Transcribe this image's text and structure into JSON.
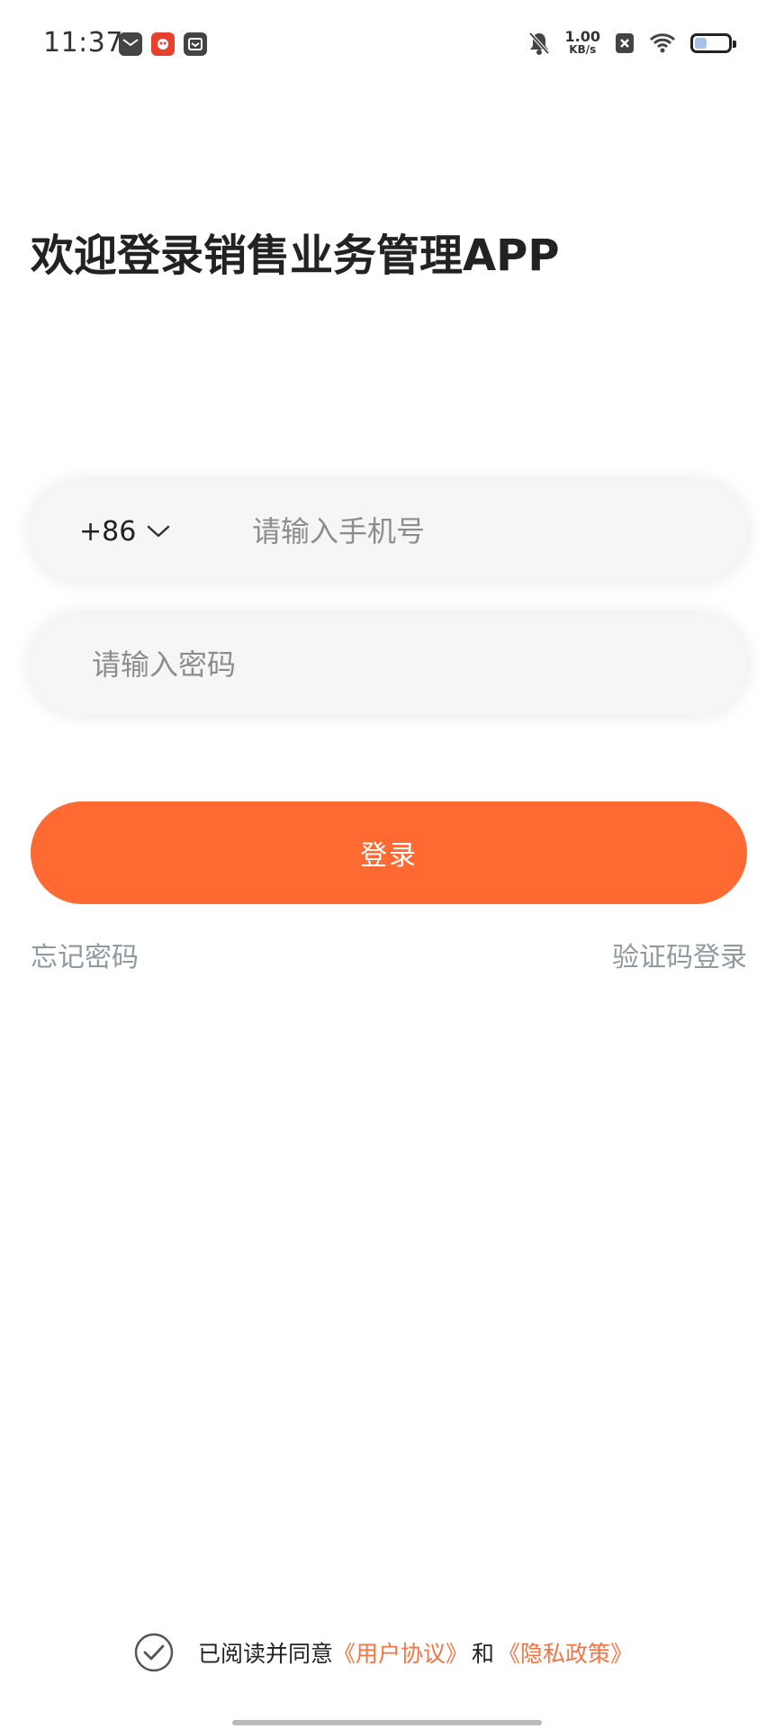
{
  "status_bar": {
    "time": "11:37",
    "net_speed_value": "1.00",
    "net_speed_unit": "KB/s",
    "battery_level": 0.35,
    "left_icons": [
      "mail-icon",
      "app-icon",
      "notes-icon"
    ],
    "right_icons": [
      "mute-icon",
      "close-icon",
      "wifi-icon",
      "battery-icon"
    ]
  },
  "title": "欢迎登录销售业务管理APP",
  "form": {
    "country_code": "+86",
    "phone_placeholder": "请输入手机号",
    "password_placeholder": "请输入密码",
    "login_label": "登录",
    "forgot_password": "忘记密码",
    "sms_login": "验证码登录"
  },
  "agreement": {
    "prefix": "已阅读并同意",
    "user_agreement": "《用户协议》",
    "conjunction": "和",
    "privacy_policy": "《隐私政策》"
  },
  "colors": {
    "accent": "#ff6a33",
    "link": "#f27545",
    "muted": "#8f9aa0",
    "field_bg": "#f6f6f6"
  }
}
